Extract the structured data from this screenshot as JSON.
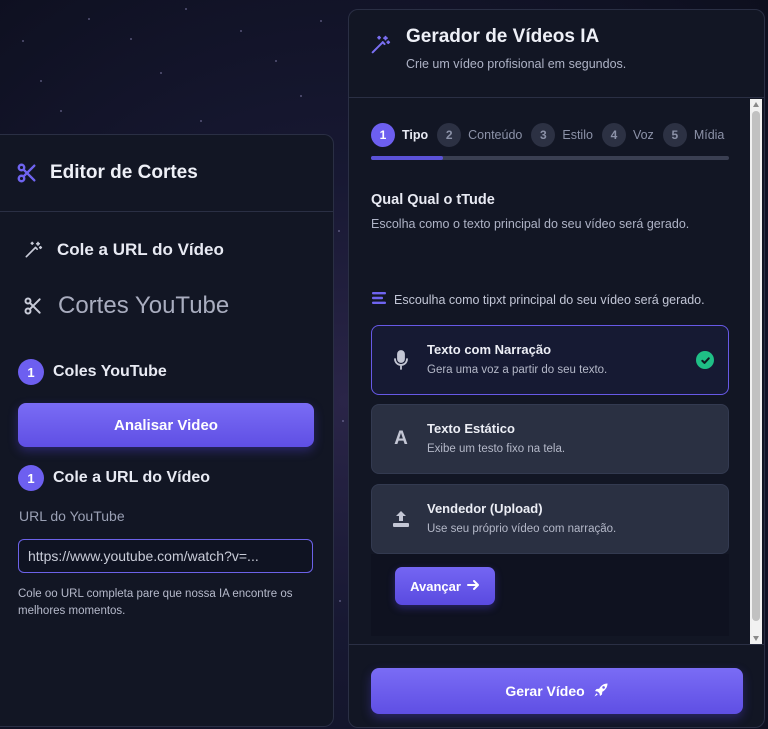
{
  "colors": {
    "accent": "#6d5ff0",
    "panel": "#121624",
    "success": "#1fbf86"
  },
  "left_panel": {
    "title": "Editor de Cortes",
    "title_icon": "scissors-icon",
    "row1_label": "Cole a URL do Vídeo",
    "row1_icon": "magic-wand-icon",
    "row2_label": "Cortes YouTube",
    "row2_icon": "scissors-icon",
    "step1_number": "1",
    "step1_label": "Coles YouTube",
    "analyze_button": "Analisar Video",
    "step2_number": "1",
    "step2_label": "Cole a URL do Vídeo",
    "field_label": "URL do YouTube",
    "url_placeholder": "https://www.youtube.com/watch?v=...",
    "help_text": "Cole oo URL completa pare que nossa IA encontre os melhores momentos."
  },
  "right_panel": {
    "title": "Gerador de Vídeos IA",
    "title_icon": "magic-wand-icon",
    "subtitle": "Crie um vídeo profisional em segundos.",
    "steps": [
      {
        "number": "1",
        "label": "Tipo",
        "active": true
      },
      {
        "number": "2",
        "label": "Conteúdo",
        "active": false
      },
      {
        "number": "3",
        "label": "Estilo",
        "active": false
      },
      {
        "number": "4",
        "label": "Voz",
        "active": false
      },
      {
        "number": "5",
        "label": "Mídia",
        "active": false
      }
    ],
    "progress": 0.2,
    "question_title": "Qual Qual o tTude",
    "question_desc": "Escolha como o texto principal do seu vídeo será gerado.",
    "section_label": "Escoulha como tipxt principal do seu vídeo será gerado.",
    "section_icon": "list-icon",
    "options": [
      {
        "title": "Texto com Narração",
        "desc": "Gera uma voz a partir do seu texto.",
        "icon": "microphone-icon",
        "selected": true
      },
      {
        "title": "Texto Estático",
        "desc": "Exibe um testo fixo na tela.",
        "icon": "text-a-icon",
        "selected": false
      },
      {
        "title": "Vendedor (Upload)",
        "desc": "Use seu próprio vídeo com narração.",
        "icon": "upload-icon",
        "selected": false
      }
    ],
    "next_button": "Avançar",
    "generate_button": "Gerar Vídeo"
  }
}
